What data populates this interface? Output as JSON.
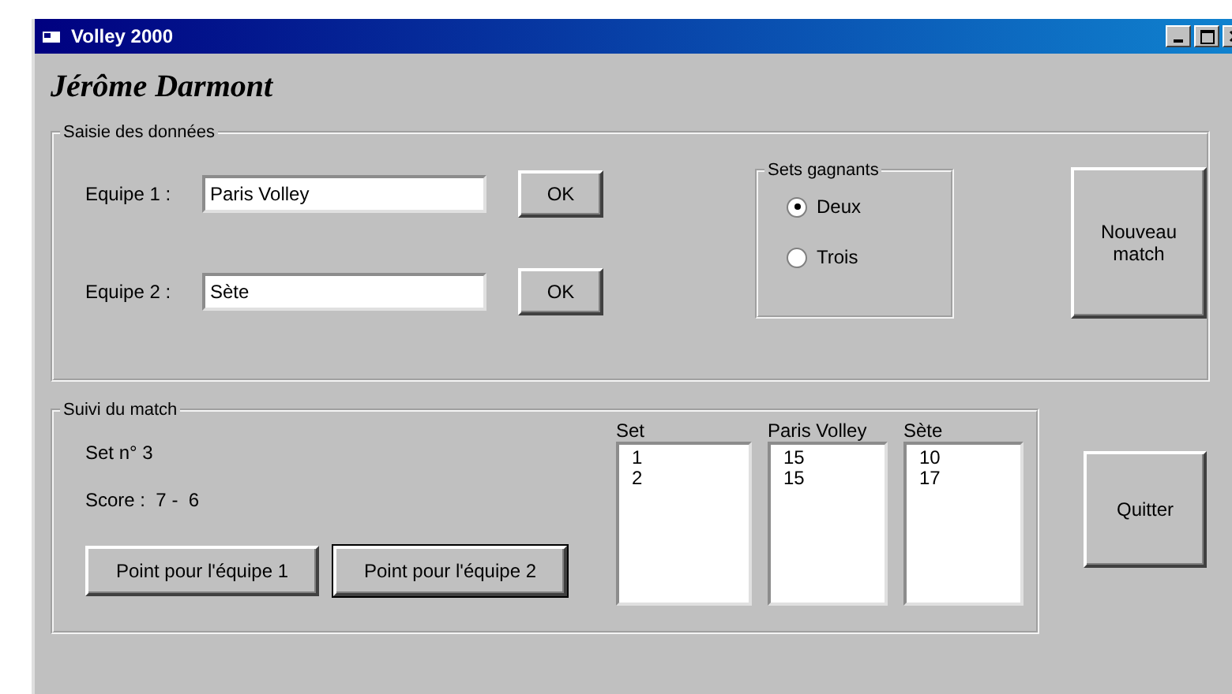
{
  "window": {
    "title": "Volley 2000"
  },
  "author": "Jérôme Darmont",
  "data_entry": {
    "title": "Saisie des données",
    "teams": [
      {
        "label": "Equipe 1 :",
        "value": "Paris Volley",
        "button": "OK"
      },
      {
        "label": "Equipe 2 :",
        "value": "Sète",
        "button": "OK"
      }
    ],
    "sets_group": {
      "title": "Sets gagnants",
      "options": [
        {
          "label": "Deux",
          "selected": true
        },
        {
          "label": "Trois",
          "selected": false
        }
      ]
    },
    "new_match_button": "Nouveau match"
  },
  "match_tracking": {
    "title": "Suivi du match",
    "set_number": "Set n° 3",
    "score": "Score :  7 -  6",
    "point_buttons": [
      {
        "label": "Point pour l'équipe 1",
        "focused": false
      },
      {
        "label": "Point pour l'équipe 2",
        "focused": true
      }
    ],
    "lists": [
      {
        "header": "Set",
        "items": [
          "1",
          "2"
        ]
      },
      {
        "header": "Paris Volley",
        "items": [
          "15",
          "15"
        ]
      },
      {
        "header": "Sète",
        "items": [
          "10",
          "17"
        ]
      }
    ]
  },
  "quit_button": "Quitter"
}
